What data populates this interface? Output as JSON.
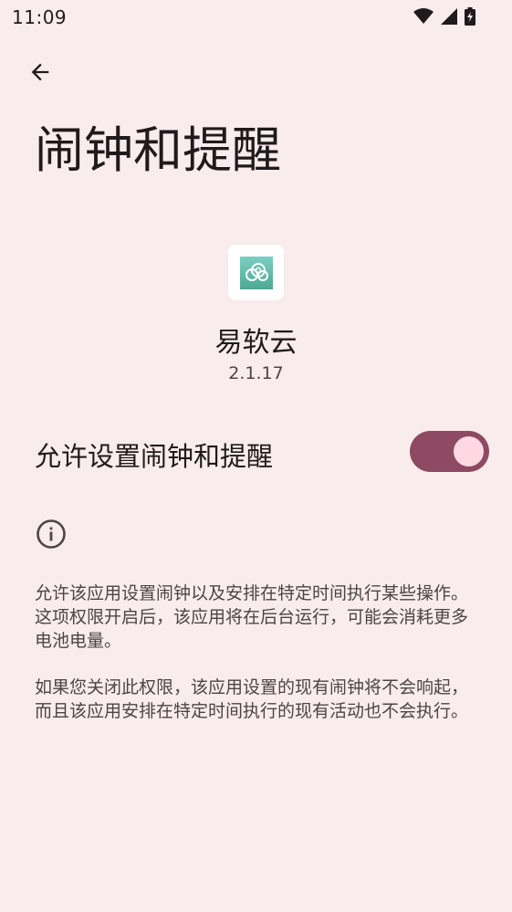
{
  "status_bar": {
    "time": "11:09",
    "icons": [
      "wifi-icon",
      "signal-icon",
      "battery-charging-icon"
    ]
  },
  "header": {
    "back_icon": "arrow-back-icon",
    "title": "闹钟和提醒"
  },
  "app": {
    "name": "易软云",
    "version": "2.1.17",
    "icon_colors": {
      "bg_top": "#7ccfc4",
      "bg_bottom": "#4da893"
    }
  },
  "permission": {
    "label": "允许设置闹钟和提醒",
    "enabled": true,
    "switch_track_color": "#8d4a62",
    "switch_thumb_color": "#ffd8e4"
  },
  "info": {
    "icon": "info-icon",
    "paragraph1": "允许该应用设置闹钟以及安排在特定时间执行某些操作。这项权限开启后，该应用将在后台运行，可能会消耗更多电池电量。",
    "paragraph2": "如果您关闭此权限，该应用设置的现有闹钟将不会响起，而且该应用安排在特定时间执行的现有活动也不会执行。"
  }
}
